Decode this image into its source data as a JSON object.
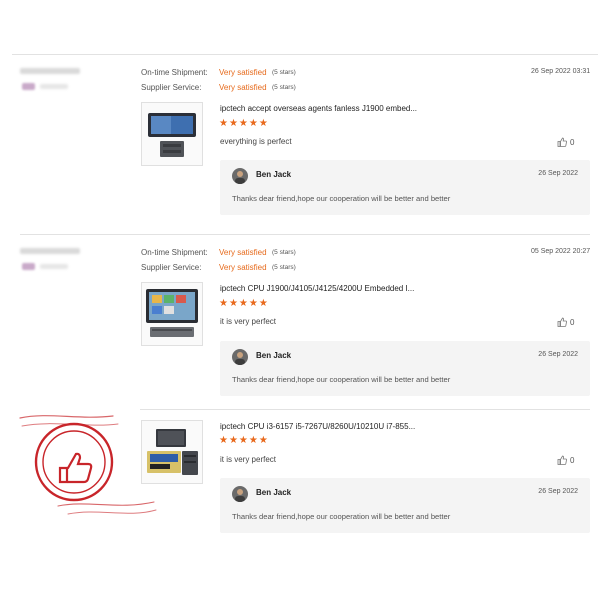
{
  "colors": {
    "accent": "#e8691c",
    "stamp": "#c8252a"
  },
  "reviews": [
    {
      "shipment_label": "On-time Shipment:",
      "shipment_value": "Very satisfied",
      "shipment_stars": "(5 stars)",
      "service_label": "Supplier Service:",
      "service_value": "Very satisfied",
      "service_stars": "(5 stars)",
      "date": "26 Sep 2022 03:31",
      "product_title": "ipctech accept overseas agents fanless J1900 embed...",
      "stars": "★★★★★",
      "comment": "everything is perfect",
      "likes": "0",
      "reply": {
        "name": "Ben Jack",
        "date": "26 Sep 2022",
        "text": "Thanks dear friend,hope our cooperation will be better and better"
      }
    },
    {
      "shipment_label": "On-time Shipment:",
      "shipment_value": "Very satisfied",
      "shipment_stars": "(5 stars)",
      "service_label": "Supplier Service:",
      "service_value": "Very satisfied",
      "service_stars": "(5 stars)",
      "date": "05 Sep 2022 20:27",
      "product_title": "ipctech CPU J1900/J4105/J4125/4200U Embedded I...",
      "stars": "★★★★★",
      "comment": "it is very perfect",
      "likes": "0",
      "reply": {
        "name": "Ben Jack",
        "date": "26 Sep 2022",
        "text": "Thanks dear friend,hope our cooperation will be better and better"
      }
    },
    {
      "product_title": "ipctech CPU i3-6157 i5-7267U/8260U/10210U i7-855...",
      "stars": "★★★★★",
      "comment": "it is very perfect",
      "likes": "0",
      "reply": {
        "name": "Ben Jack",
        "date": "26 Sep 2022",
        "text": "Thanks dear friend,hope our cooperation will be better and better"
      }
    }
  ]
}
